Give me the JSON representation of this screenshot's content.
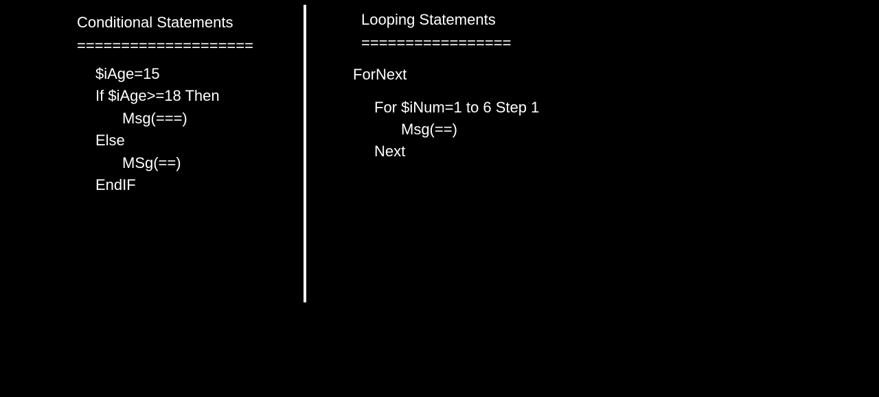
{
  "left": {
    "heading": "Conditional Statements",
    "underline": "====================",
    "code": [
      "$iAge=15",
      "If $iAge>=18 Then",
      "Msg(===)",
      "Else",
      "MSg(==)",
      "EndIF"
    ]
  },
  "right": {
    "heading": "Looping Statements",
    "underline": "=================",
    "subheading": "ForNext",
    "code": [
      "For $iNum=1 to 6 Step 1",
      "Msg(==)",
      "Next"
    ]
  },
  "colors": {
    "background": "#000000",
    "text": "#ffffff",
    "divider": "#ffffff"
  }
}
